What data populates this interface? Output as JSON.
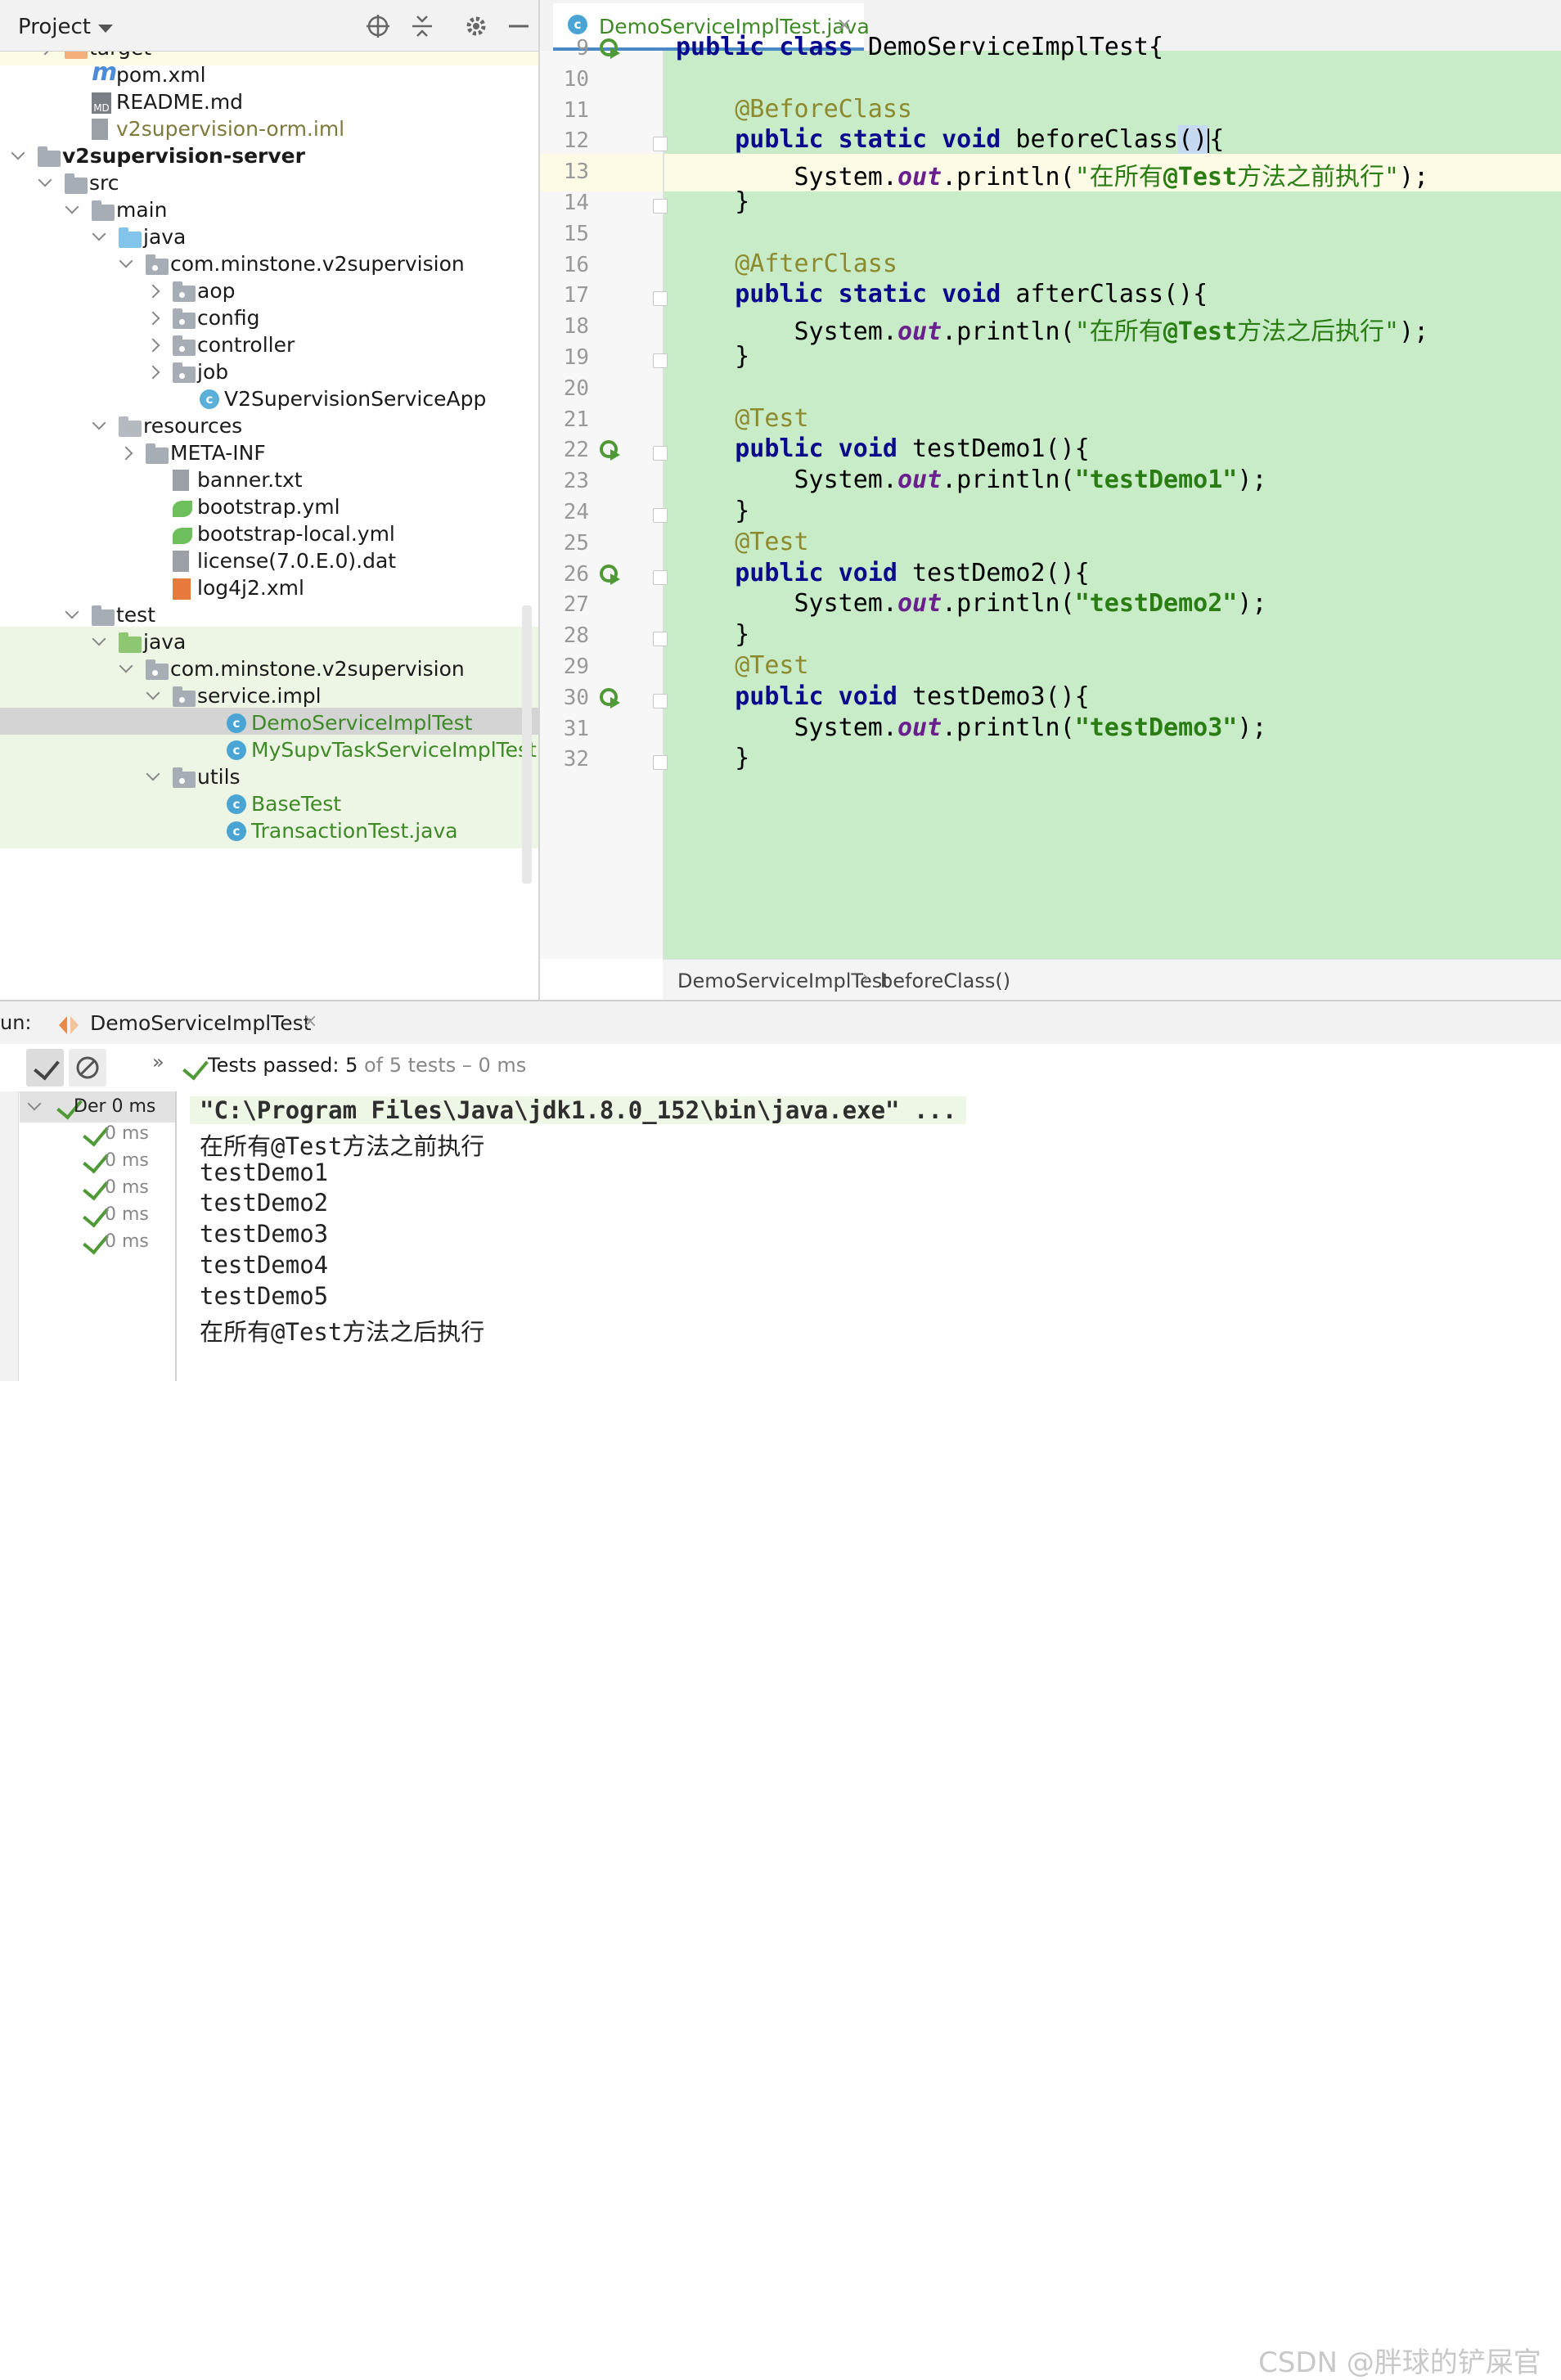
{
  "project_panel": {
    "title": "Project",
    "tree": [
      {
        "label": "target",
        "indent": 1,
        "icon": "folder-orange-icon",
        "arrow": "right",
        "row": "yellow"
      },
      {
        "label": "pom.xml",
        "indent": 2,
        "icon": "maven-icon",
        "arrow": "none"
      },
      {
        "label": "README.md",
        "indent": 2,
        "icon": "markdown-file-icon",
        "arrow": "none"
      },
      {
        "label": "v2supervision-orm.iml",
        "indent": 2,
        "icon": "iml-file-icon",
        "arrow": "none",
        "style": "olive"
      },
      {
        "label": "v2supervision-server",
        "indent": 0,
        "icon": "module-folder-icon",
        "arrow": "down",
        "style": "bold"
      },
      {
        "label": "src",
        "indent": 1,
        "icon": "folder-icon",
        "arrow": "down"
      },
      {
        "label": "main",
        "indent": 2,
        "icon": "folder-icon",
        "arrow": "down"
      },
      {
        "label": "java",
        "indent": 3,
        "icon": "folder-blue-icon",
        "arrow": "down"
      },
      {
        "label": "com.minstone.v2supervision",
        "indent": 4,
        "icon": "package-icon",
        "arrow": "down"
      },
      {
        "label": "aop",
        "indent": 5,
        "icon": "package-icon",
        "arrow": "right"
      },
      {
        "label": "config",
        "indent": 5,
        "icon": "package-icon",
        "arrow": "right"
      },
      {
        "label": "controller",
        "indent": 5,
        "icon": "package-icon",
        "arrow": "right"
      },
      {
        "label": "job",
        "indent": 5,
        "icon": "package-icon",
        "arrow": "right"
      },
      {
        "label": "V2SupervisionServiceApp",
        "indent": 6,
        "icon": "spring-class-icon",
        "arrow": "none"
      },
      {
        "label": "resources",
        "indent": 3,
        "icon": "resources-folder-icon",
        "arrow": "down"
      },
      {
        "label": "META-INF",
        "indent": 4,
        "icon": "folder-icon",
        "arrow": "right"
      },
      {
        "label": "banner.txt",
        "indent": 5,
        "icon": "text-file-icon",
        "arrow": "none"
      },
      {
        "label": "bootstrap.yml",
        "indent": 5,
        "icon": "yaml-file-icon",
        "arrow": "none"
      },
      {
        "label": "bootstrap-local.yml",
        "indent": 5,
        "icon": "yaml-file-icon",
        "arrow": "none"
      },
      {
        "label": "license(7.0.E.0).dat",
        "indent": 5,
        "icon": "text-file-icon",
        "arrow": "none"
      },
      {
        "label": "log4j2.xml",
        "indent": 5,
        "icon": "xml-file-icon",
        "arrow": "none"
      },
      {
        "label": "test",
        "indent": 2,
        "icon": "folder-icon",
        "arrow": "down"
      },
      {
        "label": "java",
        "indent": 3,
        "icon": "folder-green-icon",
        "arrow": "down",
        "row": "green"
      },
      {
        "label": "com.minstone.v2supervision",
        "indent": 4,
        "icon": "package-icon",
        "arrow": "down",
        "row": "green"
      },
      {
        "label": "service.impl",
        "indent": 5,
        "icon": "package-icon",
        "arrow": "down",
        "row": "green"
      },
      {
        "label": "DemoServiceImplTest",
        "indent": 7,
        "icon": "test-class-icon",
        "arrow": "none",
        "style": "green",
        "row": "selected"
      },
      {
        "label": "MySupvTaskServiceImplTest",
        "indent": 7,
        "icon": "test-class-icon",
        "arrow": "none",
        "style": "green",
        "row": "green"
      },
      {
        "label": "utils",
        "indent": 5,
        "icon": "package-icon",
        "arrow": "down",
        "row": "green"
      },
      {
        "label": "BaseTest",
        "indent": 7,
        "icon": "class-icon",
        "arrow": "none",
        "style": "green",
        "row": "green"
      },
      {
        "label": "TransactionTest.java",
        "indent": 7,
        "icon": "class-icon",
        "arrow": "none",
        "style": "green",
        "row": "green"
      }
    ]
  },
  "editor": {
    "tab_label": "DemoServiceImplTest.java",
    "tab_close": "×",
    "lines": [
      {
        "n": "9",
        "run": true,
        "fold": false,
        "code": [
          [
            "kw",
            "public class "
          ],
          [
            "",
            "DemoServiceImplTest{"
          ]
        ]
      },
      {
        "n": "10",
        "code": []
      },
      {
        "n": "11",
        "code": [
          [
            "ann",
            "    @BeforeClass"
          ]
        ]
      },
      {
        "n": "12",
        "fold": true,
        "current": true,
        "code": [
          [
            "kw",
            "    public static void "
          ],
          [
            "",
            "beforeClass"
          ],
          [
            "paren",
            "()"
          ],
          [
            "caret",
            ""
          ],
          [
            "",
            "{"
          ]
        ]
      },
      {
        "n": "13",
        "code": [
          [
            "",
            "        System."
          ],
          [
            "ital",
            "out"
          ],
          [
            "",
            ".println("
          ],
          [
            "str",
            "\"在所有"
          ],
          [
            "strb",
            "@Test"
          ],
          [
            "str",
            "方法之前执行\""
          ],
          [
            "",
            ");"
          ]
        ]
      },
      {
        "n": "14",
        "fold": true,
        "code": [
          [
            "",
            "    }"
          ]
        ]
      },
      {
        "n": "15",
        "code": []
      },
      {
        "n": "16",
        "code": [
          [
            "ann",
            "    @AfterClass"
          ]
        ]
      },
      {
        "n": "17",
        "fold": true,
        "code": [
          [
            "kw",
            "    public static void "
          ],
          [
            "",
            "afterClass(){"
          ]
        ]
      },
      {
        "n": "18",
        "code": [
          [
            "",
            "        System."
          ],
          [
            "ital",
            "out"
          ],
          [
            "",
            ".println("
          ],
          [
            "str",
            "\"在所有"
          ],
          [
            "strb",
            "@Test"
          ],
          [
            "str",
            "方法之后执行\""
          ],
          [
            "",
            ");"
          ]
        ]
      },
      {
        "n": "19",
        "fold": true,
        "code": [
          [
            "",
            "    }"
          ]
        ]
      },
      {
        "n": "20",
        "code": []
      },
      {
        "n": "21",
        "code": [
          [
            "ann",
            "    @Test"
          ]
        ]
      },
      {
        "n": "22",
        "run": true,
        "fold": true,
        "code": [
          [
            "kw",
            "    public void "
          ],
          [
            "",
            "testDemo1(){"
          ]
        ]
      },
      {
        "n": "23",
        "code": [
          [
            "",
            "        System."
          ],
          [
            "ital",
            "out"
          ],
          [
            "",
            ".println("
          ],
          [
            "strb",
            "\"testDemo1\""
          ],
          [
            "",
            ");"
          ]
        ]
      },
      {
        "n": "24",
        "fold": true,
        "code": [
          [
            "",
            "    }"
          ]
        ]
      },
      {
        "n": "25",
        "code": [
          [
            "ann",
            "    @Test"
          ]
        ]
      },
      {
        "n": "26",
        "run": true,
        "fold": true,
        "code": [
          [
            "kw",
            "    public void "
          ],
          [
            "",
            "testDemo2(){"
          ]
        ]
      },
      {
        "n": "27",
        "code": [
          [
            "",
            "        System."
          ],
          [
            "ital",
            "out"
          ],
          [
            "",
            ".println("
          ],
          [
            "strb",
            "\"testDemo2\""
          ],
          [
            "",
            ");"
          ]
        ]
      },
      {
        "n": "28",
        "fold": true,
        "code": [
          [
            "",
            "    }"
          ]
        ]
      },
      {
        "n": "29",
        "code": [
          [
            "ann",
            "    @Test"
          ]
        ]
      },
      {
        "n": "30",
        "run": true,
        "fold": true,
        "code": [
          [
            "kw",
            "    public void "
          ],
          [
            "",
            "testDemo3(){"
          ]
        ]
      },
      {
        "n": "31",
        "code": [
          [
            "",
            "        System."
          ],
          [
            "ital",
            "out"
          ],
          [
            "",
            ".println("
          ],
          [
            "strb",
            "\"testDemo3\""
          ],
          [
            "",
            ");"
          ]
        ]
      },
      {
        "n": "32",
        "fold": true,
        "code": [
          [
            "",
            "    }"
          ]
        ]
      }
    ],
    "breadcrumb": [
      "DemoServiceImplTest",
      "beforeClass()"
    ],
    "breadcrumb_sep": "›"
  },
  "run_panel": {
    "label": "un:",
    "tab_name": "DemoServiceImplTest",
    "tab_close": "×",
    "status_prefix": "Tests passed: ",
    "status_count": "5",
    "status_rest": " of 5 tests – 0 ms",
    "toolbar_more": "»",
    "tests": [
      {
        "name": "Der",
        "time": "0 ms",
        "root": true
      },
      {
        "name": "",
        "time": "0 ms"
      },
      {
        "name": "",
        "time": "0 ms"
      },
      {
        "name": "",
        "time": "0 ms"
      },
      {
        "name": "",
        "time": "0 ms"
      },
      {
        "name": "",
        "time": "0 ms"
      }
    ],
    "console": [
      "\"C:\\Program Files\\Java\\jdk1.8.0_152\\bin\\java.exe\" ...",
      "在所有@Test方法之前执行",
      "testDemo1",
      "testDemo2",
      "testDemo3",
      "testDemo4",
      "testDemo5",
      "在所有@Test方法之后执行"
    ]
  },
  "watermark": "CSDN @胖球的铲屎官",
  "colors": {
    "accent_blue": "#4a88c7",
    "code_background": "#c8ebc8",
    "pass_green": "#4f9a36",
    "keyword": "#0a0a8c",
    "annotation": "#8c8a2c",
    "string": "#2a7d13"
  }
}
